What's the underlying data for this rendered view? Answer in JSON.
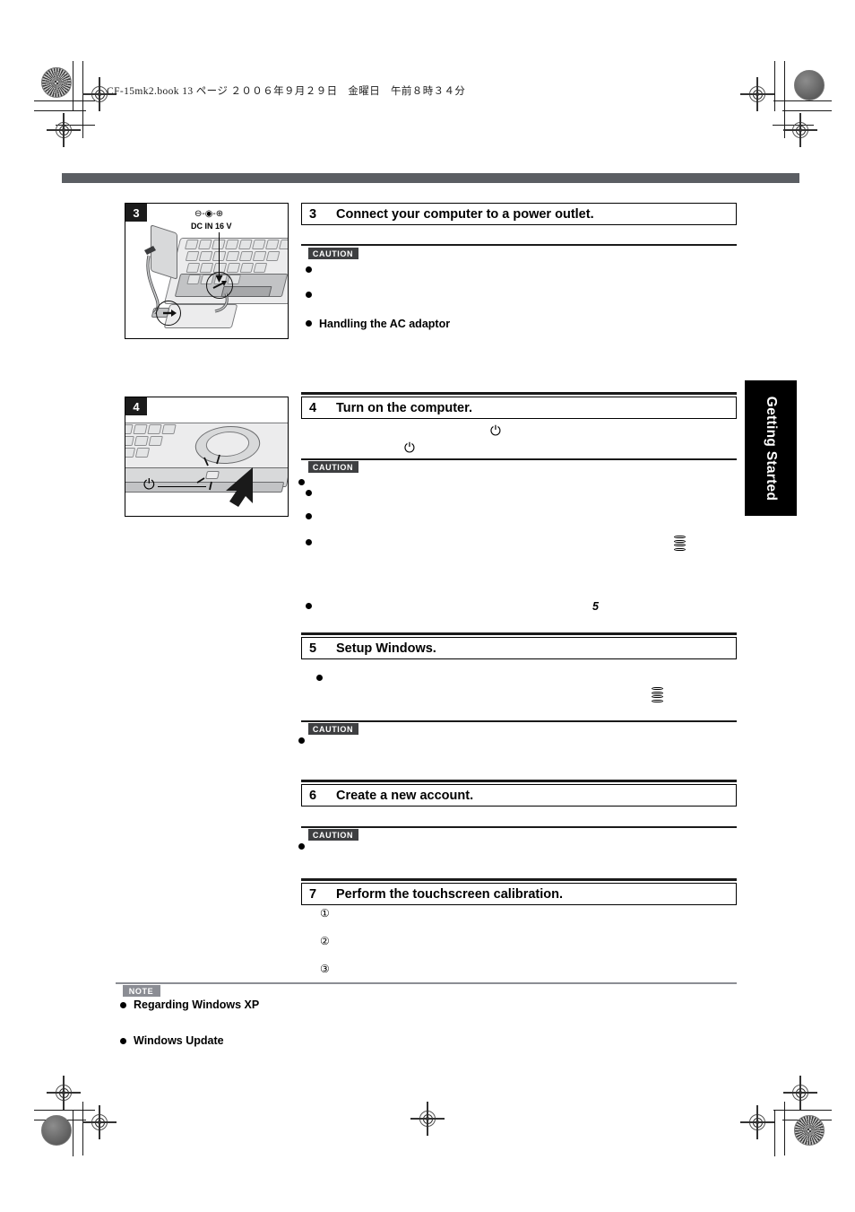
{
  "page": {
    "imprint": "CF-15mk2.book  13 ページ  ２００６年９月２９日　金曜日　午前８時３４分",
    "thumb_tab": "Getting Started",
    "rule_color": "#5b5e63"
  },
  "steps": [
    {
      "number": "3",
      "title": "Connect your computer to a power outlet.",
      "callout": "CAUTION",
      "bullets": [
        "",
        "",
        "Handling the AC adaptor"
      ],
      "figure": {
        "tag": "3",
        "caption": "DC IN 16 V",
        "polarity": "⊖-◉-⊕",
        "alt": "laptop-ac-adaptor-connection"
      }
    },
    {
      "number": "4",
      "title": "Turn on the computer.",
      "callout": "CAUTION",
      "bullets": [
        "",
        "",
        "",
        "",
        ""
      ],
      "power_glyph": "⏻",
      "ref_page": "5",
      "figure": {
        "tag": "4",
        "power_glyph": "⏻",
        "alt": "laptop-power-button"
      }
    },
    {
      "number": "5",
      "title": "Setup Windows.",
      "callout": "CAUTION",
      "bullets": [
        "",
        ""
      ]
    },
    {
      "number": "6",
      "title": "Create a new account.",
      "callout": "CAUTION",
      "bullets": [
        ""
      ]
    },
    {
      "number": "7",
      "title": "Perform the touchscreen calibration.",
      "substeps": [
        "①",
        "②",
        "③"
      ]
    }
  ],
  "note": {
    "label": "NOTE",
    "items": [
      "Regarding Windows XP",
      "Windows Update"
    ]
  }
}
